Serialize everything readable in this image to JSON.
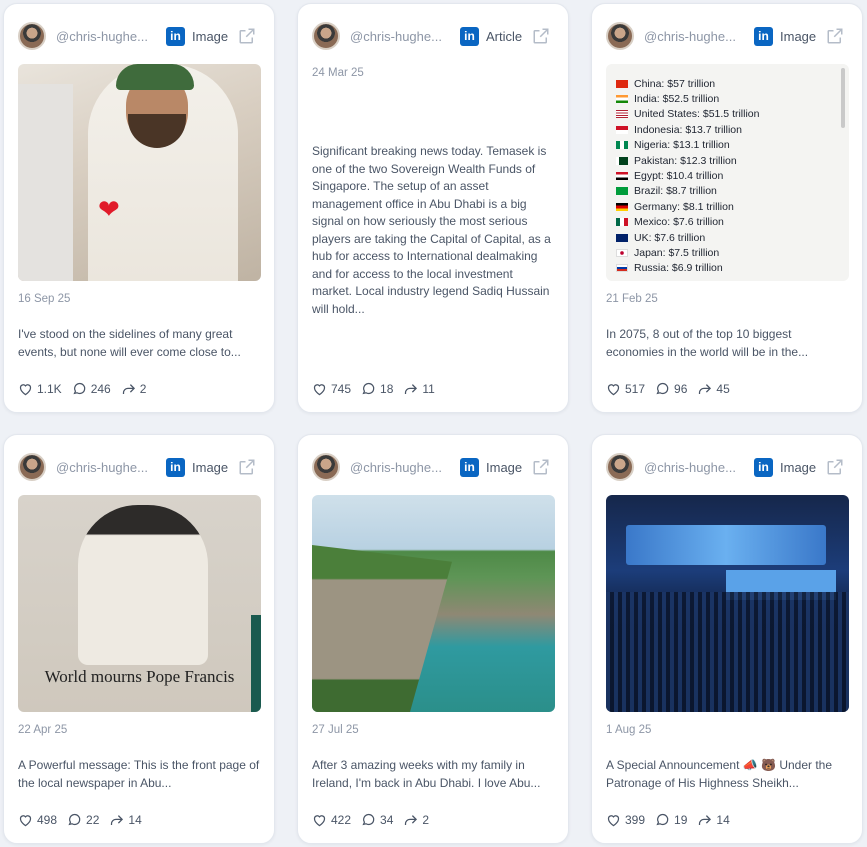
{
  "cards": [
    {
      "handle": "@chris-hughe...",
      "type": "Image",
      "date": "16 Sep 25",
      "text": "I've stood on the sidelines of many great events, but none will ever come close to...",
      "likes": "1.1K",
      "comments": "246",
      "shares": "2"
    },
    {
      "handle": "@chris-hughe...",
      "type": "Article",
      "date": "24 Mar 25",
      "text": "Significant breaking news today. Temasek is one of the two Sovereign Wealth Funds of Singapore. The setup of an asset management office in Abu Dhabi is a big signal on how seriously the most serious players are taking the Capital of Capital, as a hub for access to International dealmaking and for access to the local investment market. Local industry legend Sadiq Hussain will hold...",
      "likes": "745",
      "comments": "18",
      "shares": "11"
    },
    {
      "handle": "@chris-hughe...",
      "type": "Image",
      "date": "21 Feb 25",
      "text": "In 2075, 8 out of the top 10 biggest economies in the world will be in the...",
      "likes": "517",
      "comments": "96",
      "shares": "45",
      "media_list": [
        "China: $57 trillion",
        "India: $52.5 trillion",
        "United States: $51.5 trillion",
        "Indonesia: $13.7 trillion",
        "Nigeria: $13.1 trillion",
        "Pakistan: $12.3 trillion",
        "Egypt: $10.4 trillion",
        "Brazil: $8.7 trillion",
        "Germany: $8.1 trillion",
        "Mexico: $7.6 trillion",
        "UK: $7.6 trillion",
        "Japan: $7.5 trillion",
        "Russia: $6.9 trillion"
      ]
    },
    {
      "handle": "@chris-hughe...",
      "type": "Image",
      "date": "22 Apr 25",
      "text": "A Powerful message: This is the front page of the local newspaper in Abu...",
      "likes": "498",
      "comments": "22",
      "shares": "14",
      "media_headline": "World mourns Pope Francis"
    },
    {
      "handle": "@chris-hughe...",
      "type": "Image",
      "date": "27 Jul 25",
      "text": "After 3 amazing weeks with my family in Ireland, I'm back in Abu Dhabi. I love Abu...",
      "likes": "422",
      "comments": "34",
      "shares": "2"
    },
    {
      "handle": "@chris-hughe...",
      "type": "Image",
      "date": "1 Aug 25",
      "text": "A Special Announcement 📣 🐻 Under the Patronage of His Highness Sheikh...",
      "likes": "399",
      "comments": "19",
      "shares": "14"
    }
  ],
  "colors": {
    "linkedin": "#0a66c2",
    "background": "#eef1f6",
    "card": "#ffffff"
  },
  "icons": {
    "linkedin": "linkedin-icon",
    "external": "external-link-icon",
    "like": "heart-icon",
    "comment": "comment-icon",
    "share": "share-icon"
  }
}
